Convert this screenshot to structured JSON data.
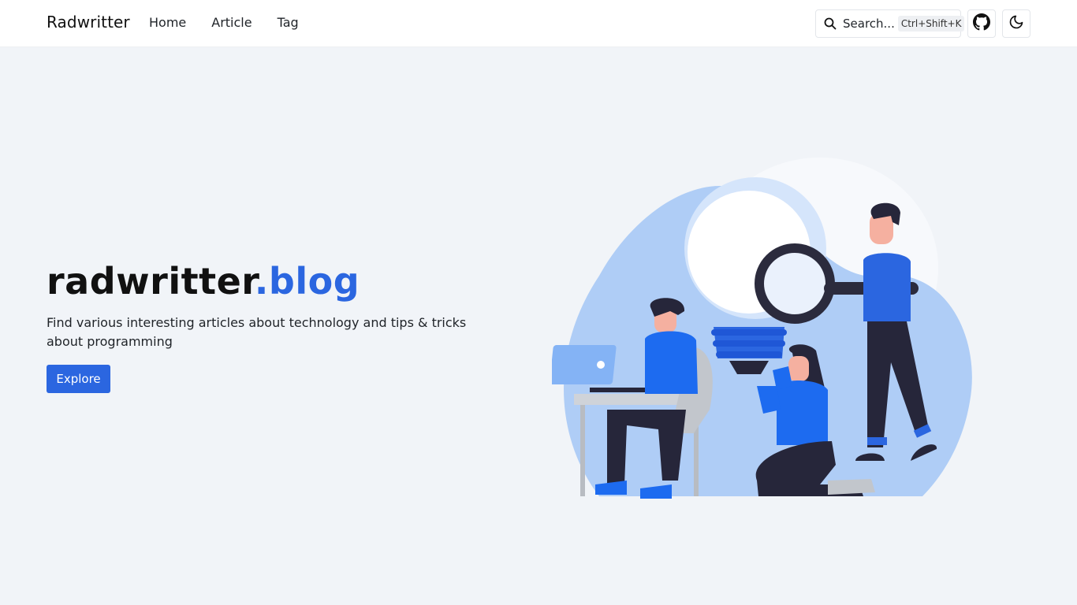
{
  "nav": {
    "brand": "Radwritter",
    "links": [
      "Home",
      "Article",
      "Tag"
    ],
    "search_label": "Search...",
    "search_shortcut": "Ctrl+Shift+K"
  },
  "hero": {
    "title_main": "radwritter",
    "title_accent": ".blog",
    "description": "Find various interesting articles about technology and tips & tricks about programming",
    "button_label": "Explore"
  },
  "icons": {
    "search": "search-icon",
    "github": "github-icon",
    "theme": "moon-icon",
    "illustration": "team-lightbulb-illustration"
  },
  "colors": {
    "accent": "#2b66e0",
    "background": "#f1f4f8",
    "navbar": "#ffffff"
  }
}
